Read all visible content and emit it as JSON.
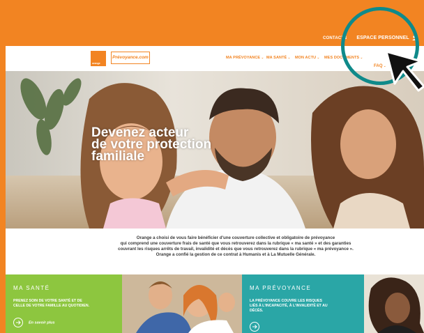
{
  "topbar": {
    "contacts": "CONTACTS",
    "espace_personnel": "ESPACE PERSONNEL"
  },
  "header": {
    "brand_logo_text": "orange",
    "site_logo_text": "Prévoyance.com",
    "nav": [
      {
        "label": "MA PRÉVOYANCE",
        "chevron": "⌄"
      },
      {
        "label": "MA SANTÉ",
        "chevron": "⌄"
      },
      {
        "label": "MON ACTU",
        "chevron": "⌄"
      },
      {
        "label": "MES DOCUMENTS",
        "chevron": "⌄"
      },
      {
        "label": "FAQ",
        "chevron": "⌄"
      }
    ]
  },
  "hero": {
    "title_line1": "Devenez acteur",
    "title_line2": "de votre protection",
    "title_line3": "familiale"
  },
  "intro": {
    "line1": "Orange a choisi de vous faire bénéficier d'une couverture collective et obligatoire de prévoyance",
    "line2": "qui comprend une couverture frais de santé que vous retrouverez dans la rubrique « ma santé » et des garanties",
    "line3": "couvrant les risques arrêts de travail, invalidité et décès que vous retrouverez dans la rubrique « ma prévoyance ».",
    "line4": "Orange a confié la gestion de ce contrat à Humanis et à La Mutuelle Générale."
  },
  "cards": {
    "sante": {
      "title": "MA SANTÉ",
      "subtitle_line1": "PRENEZ SOIN DE VOTRE SANTÉ ET DE",
      "subtitle_line2": "CELLE DE VOTRE FAMILLE AU QUOTIDIEN.",
      "link": "En savoir plus"
    },
    "prevoyance": {
      "title": "MA PRÉVOYANCE",
      "subtitle_line1": "LA PRÉVOYANCE COUVRE LES RISQUES",
      "subtitle_line2": "LIÉS À L'INCAPACITÉ, À L'INVALIDITÉ ET AU",
      "subtitle_line3": "DÉCÈS."
    }
  },
  "colors": {
    "orange": "#f28422",
    "green": "#8dc63f",
    "teal": "#2aa6a6",
    "highlight": "#0f8a8a"
  },
  "icons": [
    "user-icon",
    "chevron-down-icon",
    "arrow-right-icon",
    "cursor-arrow-icon"
  ]
}
